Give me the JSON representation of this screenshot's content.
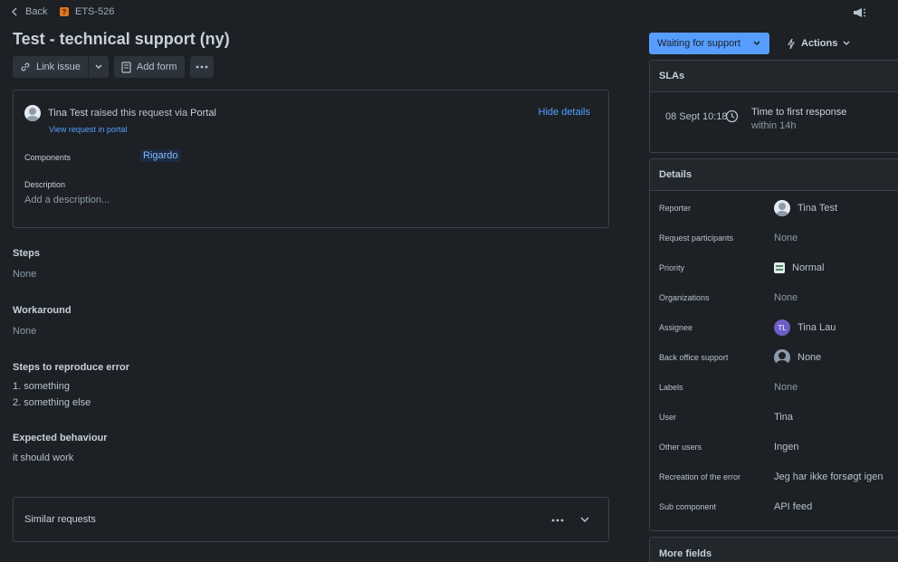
{
  "topbar": {
    "back_label": "Back",
    "issue_key": "ETS-526",
    "issue_key_icon": "?"
  },
  "issue": {
    "title": "Test - technical support (ny)"
  },
  "toolbar": {
    "link_issue": "Link issue",
    "add_form": "Add form"
  },
  "request": {
    "reporter_name": "Tina Test",
    "raised_text": "raised this request via",
    "channel": "Portal",
    "view_link": "View request in portal",
    "hide_details": "Hide details",
    "components_label": "Components",
    "components_value": "Rigardo",
    "description_label": "Description",
    "description_placeholder": "Add a description..."
  },
  "sections": [
    {
      "heading": "Steps",
      "value": "None"
    },
    {
      "heading": "Workaround",
      "value": "None"
    },
    {
      "heading": "Steps to reproduce error",
      "lines": [
        "1. something",
        "2. something else"
      ]
    },
    {
      "heading": "Expected behaviour",
      "lines": [
        "it should work"
      ]
    }
  ],
  "similar": {
    "label": "Similar requests"
  },
  "status": {
    "label": "Waiting for support",
    "actions_label": "Actions"
  },
  "slas": {
    "header": "SLAs",
    "date": "08 Sept 10:18",
    "metric": "Time to first response",
    "remaining": "within 14h"
  },
  "details": {
    "header": "Details",
    "rows": [
      {
        "label": "Reporter",
        "value": "Tina Test"
      },
      {
        "label": "Request participants",
        "value": "None"
      },
      {
        "label": "Priority",
        "value": "Normal"
      },
      {
        "label": "Organizations",
        "value": "None"
      },
      {
        "label": "Assignee",
        "value": "Tina Lau",
        "initials": "TL"
      },
      {
        "label": "Back office support",
        "value": "None"
      },
      {
        "label": "Labels",
        "value": "None"
      },
      {
        "label": "User",
        "value": "Tina"
      },
      {
        "label": "Other users",
        "value": "Ingen"
      },
      {
        "label": "Recreation of the error",
        "value": "Jeg har ikke forsøgt igen"
      },
      {
        "label": "Sub component",
        "value": "API feed"
      }
    ]
  },
  "more_fields": {
    "header": "More fields"
  },
  "colors": {
    "accent": "#579dff",
    "background": "#1d2125",
    "assignee_avatar": "#6e5dc6",
    "key_icon": "#e2761b"
  }
}
